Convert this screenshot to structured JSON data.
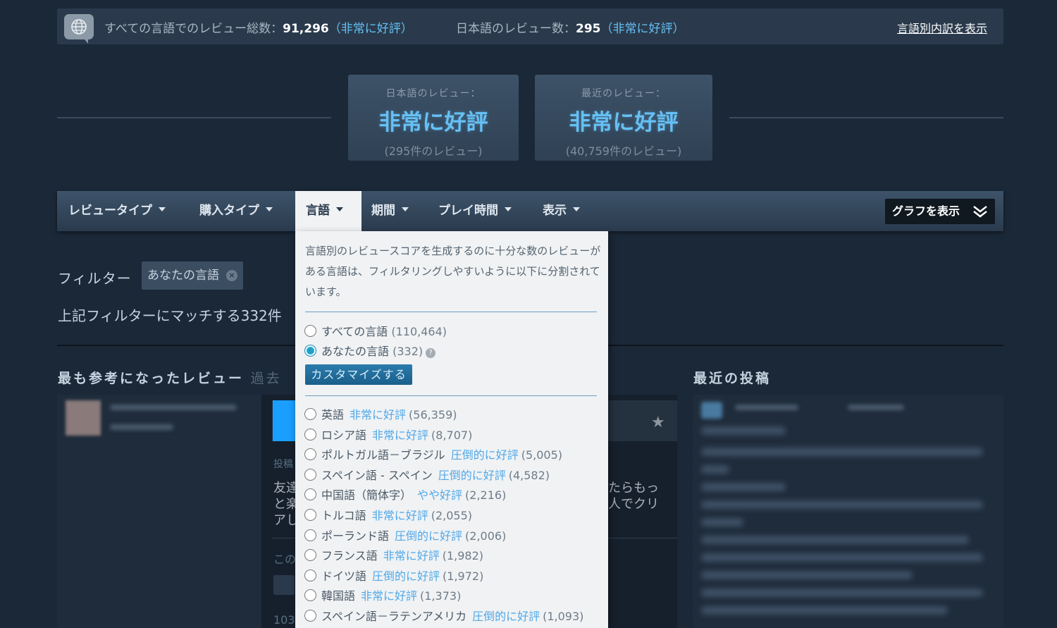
{
  "summary": {
    "all_label": "すべての言語でのレビュー総数：",
    "all_count": "91,296",
    "all_rating": "（非常に好評）",
    "ja_label": "日本語のレビュー数：",
    "ja_count": "295",
    "ja_rating": "（非常に好評）",
    "breakdown_link": "言語別内訳を表示"
  },
  "scores": [
    {
      "label": "日本語のレビュー：",
      "rating": "非常に好評",
      "count": "(295件のレビュー)"
    },
    {
      "label": "最近のレビュー：",
      "rating": "非常に好評",
      "count": "(40,759件のレビュー)"
    }
  ],
  "tabs": [
    {
      "label": "レビュータイプ"
    },
    {
      "label": "購入タイプ"
    },
    {
      "label": "言語"
    },
    {
      "label": "期間"
    },
    {
      "label": "プレイ時間"
    },
    {
      "label": "表示"
    }
  ],
  "graph_button": "グラフを表示",
  "filter": {
    "label": "フィルター",
    "chip": "あなたの言語",
    "match_text": "上記フィルターにマッチする332件"
  },
  "sections": {
    "helpful_title": "最も参考になったレビュー",
    "helpful_sub": "過去",
    "recent_title": "最近の投稿"
  },
  "review_card": {
    "posted": "投稿",
    "line1_left": "友達",
    "line1_right": "たらもっ",
    "line2_left": "と楽",
    "line2_right": "人でクリ",
    "line3_left": "アし",
    "helpful_q": "この",
    "count": "103"
  },
  "dropdown": {
    "description": "言語別のレビュースコアを生成するのに十分な数のレビューがある言語は、フィルタリングしやすいように以下に分割されています。",
    "all_languages": {
      "label": "すべての言語",
      "count": "(110,464)"
    },
    "your_language": {
      "label": "あなたの言語",
      "count": "(332)",
      "help": "?"
    },
    "customize_button": "カスタマイズする",
    "languages": [
      {
        "name": "英語",
        "rating": "非常に好評",
        "count": "(56,359)"
      },
      {
        "name": "ロシア語",
        "rating": "非常に好評",
        "count": "(8,707)"
      },
      {
        "name": "ポルトガル語－ブラジル",
        "rating": "圧倒的に好評",
        "count": "(5,005)"
      },
      {
        "name": "スペイン語 - スペイン",
        "rating": "圧倒的に好評",
        "count": "(4,582)"
      },
      {
        "name": "中国語（簡体字）",
        "rating": "やや好評",
        "count": "(2,216)"
      },
      {
        "name": "トルコ語",
        "rating": "非常に好評",
        "count": "(2,055)"
      },
      {
        "name": "ポーランド語",
        "rating": "圧倒的に好評",
        "count": "(2,006)"
      },
      {
        "name": "フランス語",
        "rating": "非常に好評",
        "count": "(1,982)"
      },
      {
        "name": "ドイツ語",
        "rating": "圧倒的に好評",
        "count": "(1,972)"
      },
      {
        "name": "韓国語",
        "rating": "非常に好評",
        "count": "(1,373)"
      },
      {
        "name": "スペイン語－ラテンアメリカ",
        "rating": "圧倒的に好評",
        "count": "(1,093)"
      }
    ]
  },
  "colors": {
    "background": "#1b2838",
    "accent_blue": "#66c0f4",
    "rating_link": "#4fa8e8",
    "dropdown_bg": "#f0f2f4"
  }
}
